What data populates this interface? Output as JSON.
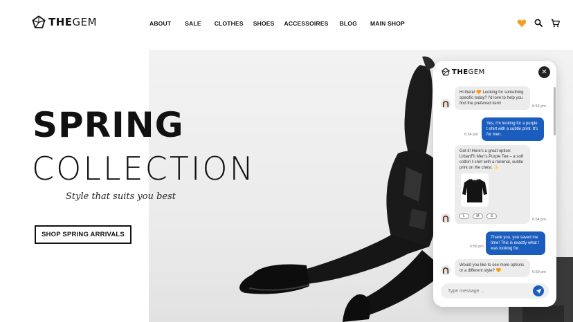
{
  "brand": {
    "name_bold": "THE",
    "name_rest": "GEM"
  },
  "nav": {
    "items": [
      {
        "label": "ABOUT"
      },
      {
        "label": "SALE"
      },
      {
        "label": "CLOTHES"
      },
      {
        "label": "SHOES"
      },
      {
        "label": "ACCESSOIRES"
      },
      {
        "label": "BLOG"
      },
      {
        "label": "MAIN SHOP"
      }
    ]
  },
  "header_icons": [
    "heart-icon",
    "search-icon",
    "cart-icon"
  ],
  "hero": {
    "title_line1": "SPRING",
    "title_line2": "COLLECTION",
    "tagline": "Style that suits you best",
    "cta_label": "SHOP SPRING ARRIVALS"
  },
  "chat": {
    "brand_bold": "THE",
    "brand_rest": "GEM",
    "messages": [
      {
        "from": "bot",
        "text": "Hi there! 🧡 Looking for something specific today? I'd love to help you find the preferred item!",
        "time": "6:52 pm"
      },
      {
        "from": "user",
        "text": "Yes, I'm looking for a purple t-shirt with a subtle print. It's for men.",
        "time": "6:54 pm"
      },
      {
        "from": "bot",
        "text": "Got it! Here's a great option: UrbanFit Men's Purple Tee – a soft cotton t-shirt with a minimal, subtle print on the chest. ✨",
        "time": "6:54 pm"
      },
      {
        "from": "user",
        "text": "Thank you, you saved me time! This is exactly what I was looking for.",
        "time": "6:56 pm"
      },
      {
        "from": "bot",
        "text": "Would you like to see more options or a different style? 🧡",
        "time": "6:59 pm"
      }
    ],
    "sizes": [
      "L",
      "M",
      "S"
    ],
    "input_placeholder": "Type message ..."
  },
  "colors": {
    "accent_blue": "#1a5dbe",
    "heart": "#f0a020"
  }
}
